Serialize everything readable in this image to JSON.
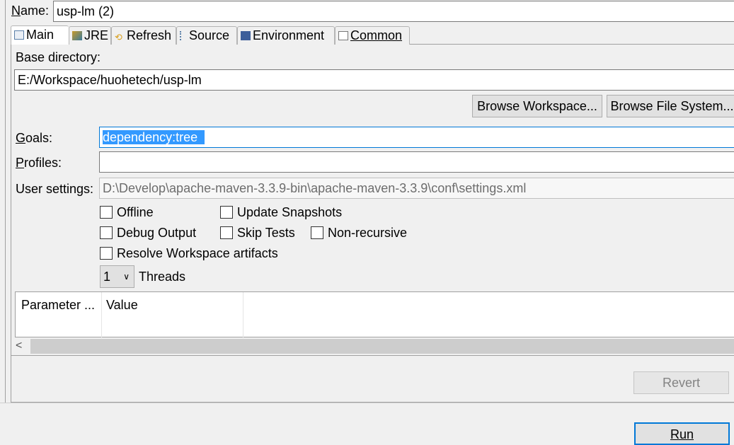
{
  "name": {
    "label": "Name:",
    "value": "usp-lm (2)"
  },
  "tabs": [
    {
      "label": "Main",
      "icon": "main-tab-icon"
    },
    {
      "label": "JRE",
      "icon": "jre-icon"
    },
    {
      "label": "Refresh",
      "icon": "refresh-icon"
    },
    {
      "label": "Source",
      "icon": "source-icon"
    },
    {
      "label": "Environment",
      "icon": "environment-icon"
    },
    {
      "label": "Common",
      "icon": "common-icon"
    }
  ],
  "main": {
    "base_dir_label": "Base directory:",
    "base_dir_value": "E:/Workspace/huohetech/usp-lm",
    "browse_workspace": "Browse Workspace...",
    "browse_fs": "Browse File System...",
    "goals_label": "Goals:",
    "goals_value": "dependency:tree",
    "profiles_label": "Profiles:",
    "profiles_value": "",
    "user_settings_label": "User settings:",
    "user_settings_value": "D:\\Develop\\apache-maven-3.3.9-bin\\apache-maven-3.3.9\\conf\\settings.xml",
    "checkboxes": [
      {
        "label": "Offline",
        "checked": false
      },
      {
        "label": "Update Snapshots",
        "checked": false
      },
      {
        "label": "Debug Output",
        "checked": false
      },
      {
        "label": "Skip Tests",
        "checked": false
      },
      {
        "label": "Non-recursive",
        "checked": false
      },
      {
        "label": "Resolve Workspace artifacts",
        "checked": false
      }
    ],
    "threads_value": "1",
    "threads_label": "Threads",
    "table_headers": [
      "Parameter ...",
      "Value"
    ]
  },
  "buttons": {
    "revert": "Revert",
    "run": "Run"
  }
}
